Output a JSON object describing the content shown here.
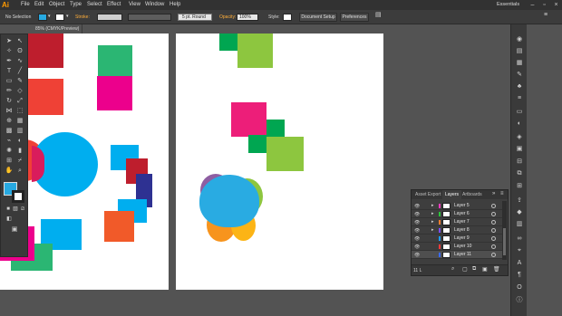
{
  "app": {
    "logo": "Ai",
    "workspace": "Essentials"
  },
  "menu": [
    "File",
    "Edit",
    "Object",
    "Type",
    "Select",
    "Effect",
    "View",
    "Window",
    "Help"
  ],
  "control_bar": {
    "selection_label": "No Selection",
    "stroke_label": "Stroke:",
    "brush_value": "5 pt. Round",
    "opacity_label": "Opacity:",
    "opacity_value": "100%",
    "style_label": "Style:",
    "document_setup": "Document Setup",
    "preferences": "Preferences"
  },
  "document_tab": {
    "title": "85% (CMYK/Preview)",
    "close": "×"
  },
  "layers_panel": {
    "tabs": [
      "Asset Export",
      "Layers",
      "Artboards"
    ],
    "rows": [
      {
        "name": "Layer 5",
        "color": "#ff3bbf"
      },
      {
        "name": "Layer 6",
        "color": "#2cc33a"
      },
      {
        "name": "Layer 7",
        "color": "#ff7e2f"
      },
      {
        "name": "Layer 8",
        "color": "#7c4dff"
      },
      {
        "name": "Layer 9",
        "color": "#1b9cff"
      },
      {
        "name": "Layer 10",
        "color": "#ff3b3b"
      },
      {
        "name": "Layer 11",
        "color": "#3b6bff"
      }
    ],
    "count": "11 L"
  },
  "colors": {
    "accent_orange": "#ff9a00",
    "panel_bg": "#3c3c3c",
    "canvas_bg": "#535353"
  }
}
